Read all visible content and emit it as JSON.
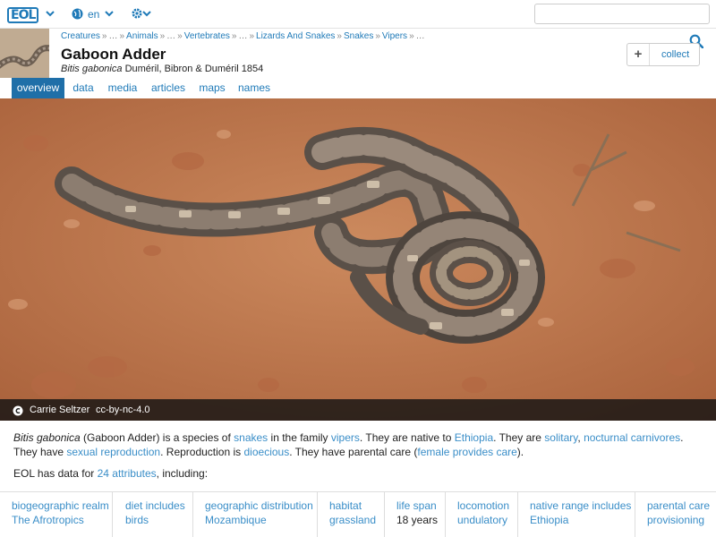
{
  "nav": {
    "logo": "EOL",
    "language": "en",
    "search_placeholder": ""
  },
  "header": {
    "breadcrumb": [
      "Creatures",
      "…",
      "Animals",
      "…",
      "Vertebrates",
      "…",
      "Lizards And Snakes",
      "Snakes",
      "Vipers",
      "…"
    ],
    "title": "Gaboon Adder",
    "scientific_name": "Bitis gabonica",
    "authority": "Duméril, Bibron & Duméril 1854",
    "collect_plus": "+",
    "collect_label": "collect"
  },
  "tabs": [
    {
      "label": "overview",
      "active": true
    },
    {
      "label": "data",
      "active": false
    },
    {
      "label": "media",
      "active": false
    },
    {
      "label": "articles",
      "active": false
    },
    {
      "label": "maps",
      "active": false
    },
    {
      "label": "names",
      "active": false
    }
  ],
  "image": {
    "author": "Carrie Seltzer",
    "license": "cc-by-nc-4.0"
  },
  "summary": {
    "p1_sci": "Bitis gabonica",
    "p1_a": " (Gaboon Adder) is a species of ",
    "l_snakes": "snakes",
    "p1_b": " in the family ",
    "l_vipers": "vipers",
    "p1_c": ". They are native to ",
    "l_ethiopia": "Ethiopia",
    "p1_d": ". They are ",
    "l_solitary": "solitary",
    "p1_e": ", ",
    "l_nocturnal": "nocturnal carnivores",
    "p1_f": ". They have ",
    "l_sexual": "sexual reproduction",
    "p1_g": ". Reproduction is ",
    "l_dioecious": "dioecious",
    "p1_h": ". They have parental care (",
    "l_female": "female provides care",
    "p1_i": ")."
  },
  "attrs_intro": {
    "pre": "EOL has data for ",
    "link": "24 attributes",
    "post": ", including:"
  },
  "attributes": [
    {
      "key": "biogeographic realm",
      "value": "The Afrotropics"
    },
    {
      "key": "diet includes",
      "value": "birds"
    },
    {
      "key": "geographic distribution",
      "value": "Mozambique"
    },
    {
      "key": "habitat",
      "value": "grassland"
    },
    {
      "key": "life span",
      "value": "18 years"
    },
    {
      "key": "locomotion",
      "value": "undulatory"
    },
    {
      "key": "native range includes",
      "value": "Ethiopia"
    },
    {
      "key": "parental care",
      "value": "provisioning"
    }
  ],
  "colors": {
    "link": "#1f7ab8",
    "active_tab": "#1f6fa8",
    "soil": "#c47a4f"
  }
}
